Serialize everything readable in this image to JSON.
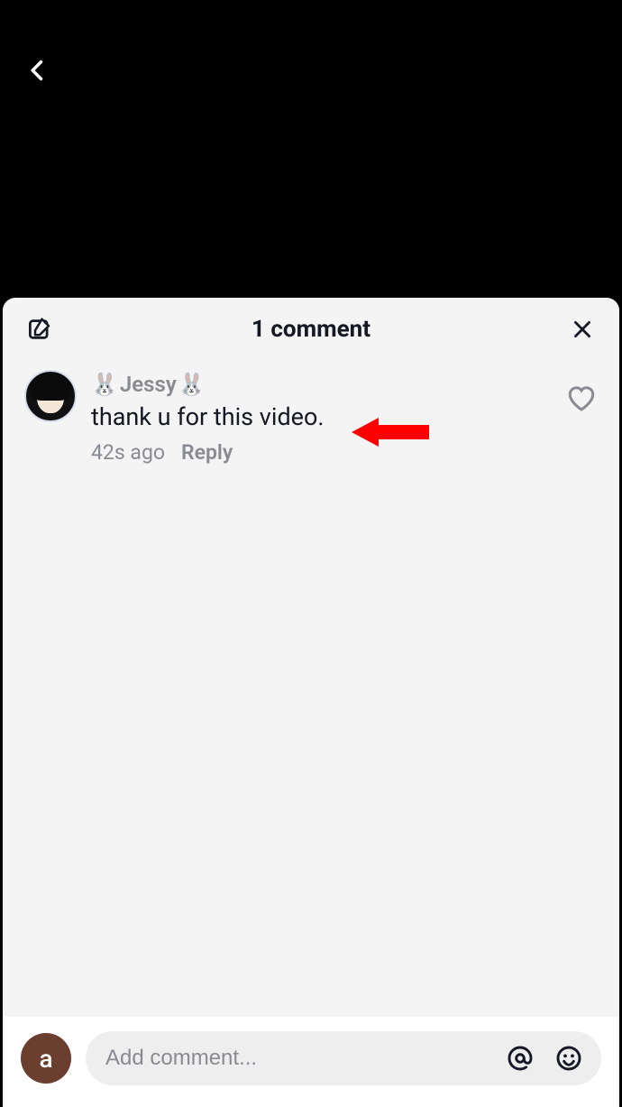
{
  "nav": {
    "back_icon": "chevron-left"
  },
  "sheet": {
    "title": "1 comment",
    "compose_icon": "compose",
    "close_icon": "close"
  },
  "comments": [
    {
      "username": "Jessy",
      "username_prefix_emoji": "🐰",
      "username_suffix_emoji": "🐰",
      "text": "thank   u for this video.",
      "time": "42s ago",
      "reply_label": "Reply"
    }
  ],
  "annotation": {
    "kind": "arrow",
    "color": "#ff0000",
    "points_to": "comment-text"
  },
  "composer": {
    "self_avatar_initial": "a",
    "placeholder": "Add comment...",
    "mention_icon": "at",
    "emoji_icon": "smiley"
  }
}
